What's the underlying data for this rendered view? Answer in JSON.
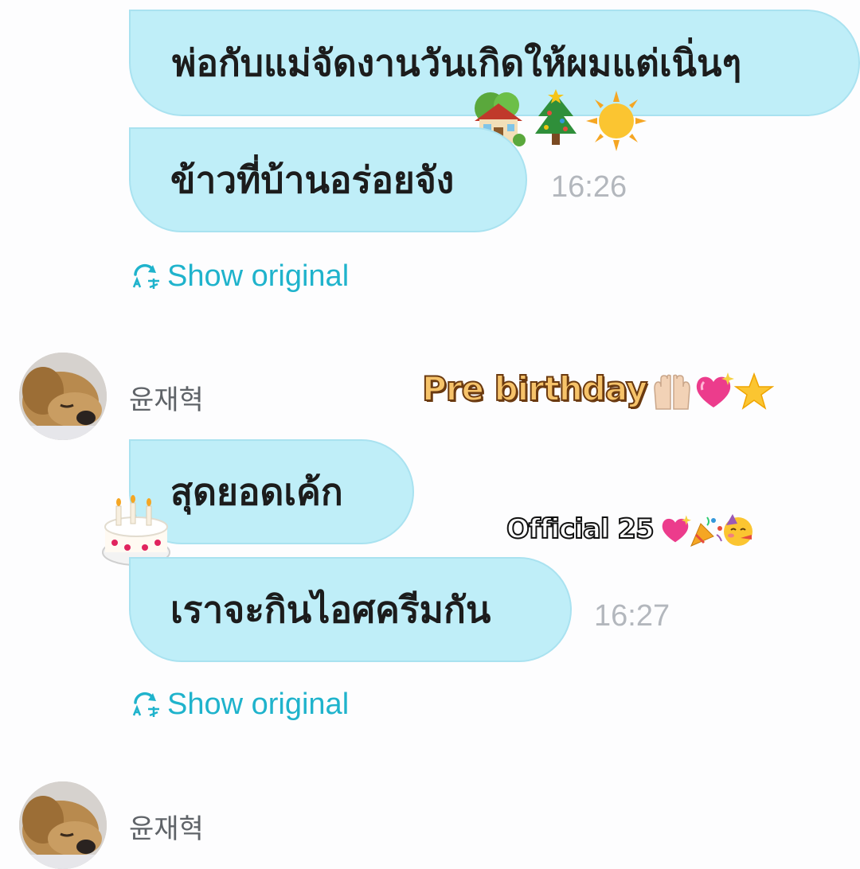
{
  "messages": [
    {
      "text": "พ่อกับแม่จัดงานวันเกิดให้ผมแต่เนิ่นๆ"
    },
    {
      "text": "ข้าวที่บ้านอร่อยจัง",
      "time": "16:26"
    },
    {
      "text": "สุดยอดเค้ก"
    },
    {
      "text": "เราจะกินไอศครีมกัน",
      "time": "16:27"
    }
  ],
  "show_original_label": "Show original",
  "sender_name": "윤재혁",
  "stickers": {
    "pre_birthday": "Pre birthday",
    "official": "Official 25"
  },
  "icons": [
    "translate-icon",
    "avatar-dog",
    "house-icon",
    "tree-icon",
    "sun-icon",
    "cake-icon",
    "hands-icon",
    "heart-icon",
    "star-icon",
    "party-icon",
    "face-icon"
  ],
  "colors": {
    "bubble": "#bfeef8",
    "link": "#1fb3cc",
    "time": "#b3b7bd",
    "sender": "#5f6368"
  }
}
